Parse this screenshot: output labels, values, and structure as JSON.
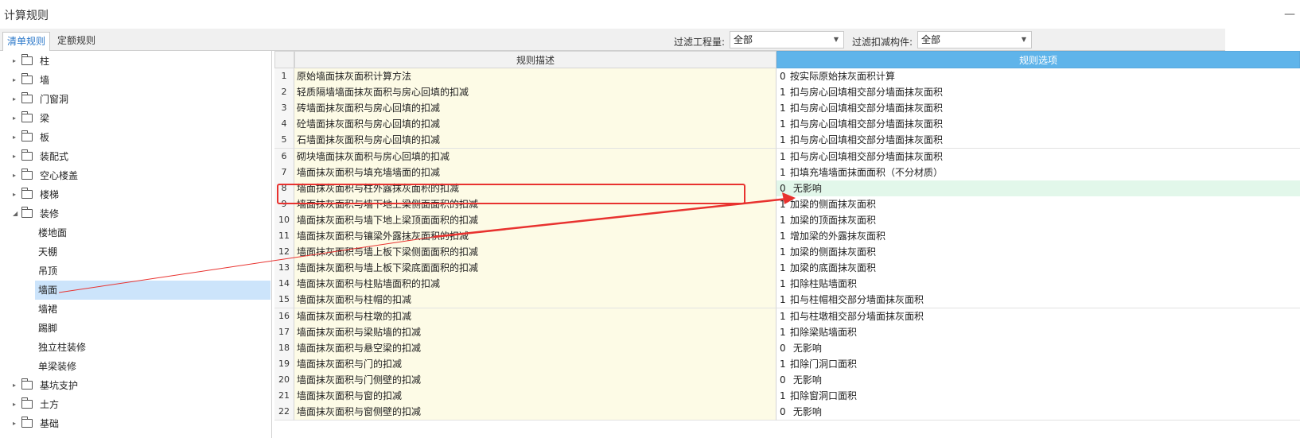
{
  "window": {
    "title": "计算规则",
    "minimize_glyph": "—"
  },
  "tabs": [
    {
      "label": "清单规则",
      "active": true
    },
    {
      "label": "定额规则",
      "active": false
    }
  ],
  "filters": {
    "quantity_label": "过滤工程量:",
    "quantity_value": "全部",
    "component_label": "过滤扣减构件:",
    "component_value": "全部"
  },
  "tree": [
    {
      "label": "柱",
      "type": "folder",
      "expanded": false
    },
    {
      "label": "墙",
      "type": "folder",
      "expanded": false
    },
    {
      "label": "门窗洞",
      "type": "folder",
      "expanded": false
    },
    {
      "label": "梁",
      "type": "folder",
      "expanded": false
    },
    {
      "label": "板",
      "type": "folder",
      "expanded": false
    },
    {
      "label": "装配式",
      "type": "folder",
      "expanded": false
    },
    {
      "label": "空心楼盖",
      "type": "folder",
      "expanded": false
    },
    {
      "label": "楼梯",
      "type": "folder",
      "expanded": false
    },
    {
      "label": "装修",
      "type": "folder",
      "expanded": true
    },
    {
      "label": "楼地面",
      "type": "child"
    },
    {
      "label": "天棚",
      "type": "child"
    },
    {
      "label": "吊顶",
      "type": "child"
    },
    {
      "label": "墙面",
      "type": "child",
      "selected": true
    },
    {
      "label": "墙裙",
      "type": "child"
    },
    {
      "label": "踢脚",
      "type": "child"
    },
    {
      "label": "独立柱装修",
      "type": "child"
    },
    {
      "label": "单梁装修",
      "type": "child"
    },
    {
      "label": "基坑支护",
      "type": "folder",
      "expanded": false
    },
    {
      "label": "土方",
      "type": "folder",
      "expanded": false
    },
    {
      "label": "基础",
      "type": "folder",
      "expanded": false
    }
  ],
  "table": {
    "header_desc": "规则描述",
    "header_opt": "规则选项",
    "rows": [
      {
        "n": "1",
        "desc": "原始墙面抹灰面积计算方法",
        "code": "0",
        "opt": "按实际原始抹灰面积计算"
      },
      {
        "n": "2",
        "desc": "轻质隔墙墙面抹灰面积与房心回填的扣减",
        "code": "1",
        "opt": "扣与房心回填相交部分墙面抹灰面积"
      },
      {
        "n": "3",
        "desc": "砖墙面抹灰面积与房心回填的扣减",
        "code": "1",
        "opt": "扣与房心回填相交部分墙面抹灰面积"
      },
      {
        "n": "4",
        "desc": "砼墙面抹灰面积与房心回填的扣减",
        "code": "1",
        "opt": "扣与房心回填相交部分墙面抹灰面积"
      },
      {
        "n": "5",
        "desc": "石墙面抹灰面积与房心回填的扣减",
        "code": "1",
        "opt": "扣与房心回填相交部分墙面抹灰面积"
      },
      {
        "n": "6",
        "desc": "砌块墙面抹灰面积与房心回填的扣减",
        "code": "1",
        "opt": "扣与房心回填相交部分墙面抹灰面积"
      },
      {
        "n": "7",
        "desc": "墙面抹灰面积与填充墙墙面的扣减",
        "code": "1",
        "opt": "扣填充墙墙面抹面面积（不分材质）"
      },
      {
        "n": "8",
        "desc": "墙面抹灰面积与柱外露抹灰面积的扣减",
        "code": "0",
        "opt": " 无影响",
        "highlight": true
      },
      {
        "n": "9",
        "desc": "墙面抹灰面积与墙下地上梁侧面面积的扣减",
        "code": "1",
        "opt": "加梁的侧面抹灰面积"
      },
      {
        "n": "10",
        "desc": "墙面抹灰面积与墙下地上梁顶面面积的扣减",
        "code": "1",
        "opt": "加梁的顶面抹灰面积"
      },
      {
        "n": "11",
        "desc": "墙面抹灰面积与镶梁外露抹灰面积的扣减",
        "code": "1",
        "opt": "增加梁的外露抹灰面积"
      },
      {
        "n": "12",
        "desc": "墙面抹灰面积与墙上板下梁侧面面积的扣减",
        "code": "1",
        "opt": "加梁的侧面抹灰面积"
      },
      {
        "n": "13",
        "desc": "墙面抹灰面积与墙上板下梁底面面积的扣减",
        "code": "1",
        "opt": "加梁的底面抹灰面积"
      },
      {
        "n": "14",
        "desc": "墙面抹灰面积与柱贴墙面积的扣减",
        "code": "1",
        "opt": "扣除柱贴墙面积"
      },
      {
        "n": "15",
        "desc": "墙面抹灰面积与柱帽的扣减",
        "code": "1",
        "opt": "扣与柱帽相交部分墙面抹灰面积"
      },
      {
        "n": "16",
        "desc": "墙面抹灰面积与柱墩的扣减",
        "code": "1",
        "opt": "扣与柱墩相交部分墙面抹灰面积"
      },
      {
        "n": "17",
        "desc": "墙面抹灰面积与梁贴墙的扣减",
        "code": "1",
        "opt": "扣除梁贴墙面积"
      },
      {
        "n": "18",
        "desc": "墙面抹灰面积与悬空梁的扣减",
        "code": "0",
        "opt": " 无影响"
      },
      {
        "n": "19",
        "desc": "墙面抹灰面积与门的扣减",
        "code": "1",
        "opt": "扣除门洞口面积"
      },
      {
        "n": "20",
        "desc": "墙面抹灰面积与门侧壁的扣减",
        "code": "0",
        "opt": " 无影响"
      },
      {
        "n": "21",
        "desc": "墙面抹灰面积与窗的扣减",
        "code": "1",
        "opt": "扣除窗洞口面积"
      },
      {
        "n": "22",
        "desc": "墙面抹灰面积与窗侧壁的扣减",
        "code": "0",
        "opt": " 无影响"
      }
    ]
  },
  "annotation": {
    "color": "#e8322f"
  }
}
